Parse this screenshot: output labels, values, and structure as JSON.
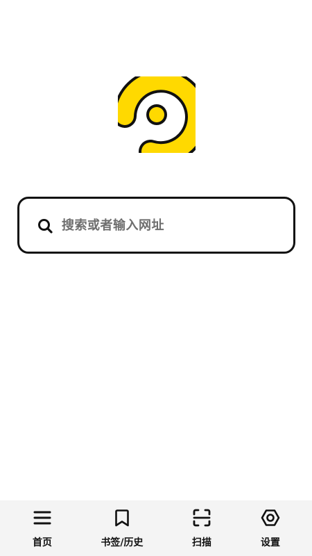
{
  "search": {
    "placeholder": "搜索或者输入网址"
  },
  "icons": {
    "logo": "yellow-spiral-logo",
    "search": "search-icon",
    "home": "menu-icon",
    "bookmarks": "bookmark-icon",
    "scan": "scan-icon",
    "settings": "settings-icon"
  },
  "colors": {
    "logo_fill": "#FFD900",
    "outline": "#111111",
    "placeholder": "#6E6E6E",
    "tabbar_bg": "#F4F4F4"
  },
  "tabbar": {
    "items": [
      {
        "label": "首页"
      },
      {
        "label": "书签/历史"
      },
      {
        "label": "扫描"
      },
      {
        "label": "设置"
      }
    ]
  }
}
